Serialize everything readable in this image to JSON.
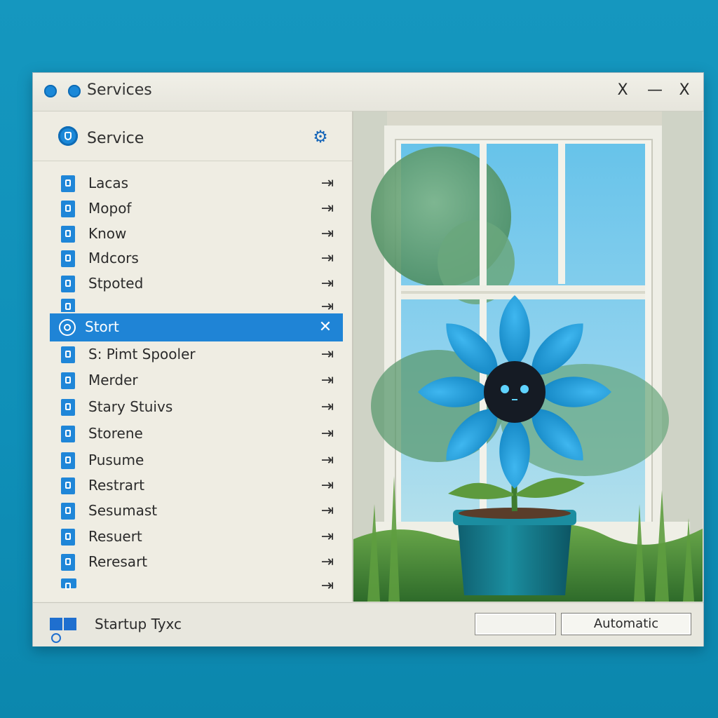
{
  "window": {
    "title": "Services",
    "controls": [
      "X",
      "—",
      "X"
    ]
  },
  "panel": {
    "header_label": "Service",
    "header_icon": "gear-icon",
    "items": [
      {
        "label": "Lacas",
        "action": "⇥"
      },
      {
        "label": "Mopof",
        "action": "⇥"
      },
      {
        "label": "Know",
        "action": "⇥"
      },
      {
        "label": "Mdcors",
        "action": "⇥"
      },
      {
        "label": "Stpoted",
        "action": "⇥"
      },
      {
        "label": "",
        "action": "⇥"
      },
      {
        "label": "Stort",
        "action": "✕",
        "selected": true
      },
      {
        "label": "S: Pimt Spooler",
        "action": "⇥"
      },
      {
        "label": "Merder",
        "action": "⇥"
      },
      {
        "label": "Stary Stuivs",
        "action": "⇥"
      },
      {
        "label": "Storene",
        "action": "⇥"
      },
      {
        "label": "Pusume",
        "action": "⇥"
      },
      {
        "label": "Restrart",
        "action": "⇥"
      },
      {
        "label": "Sesumast",
        "action": "⇥"
      },
      {
        "label": "Resuert",
        "action": "⇥"
      },
      {
        "label": "Reresart",
        "action": "⇥"
      },
      {
        "label": "",
        "action": "⇥"
      }
    ]
  },
  "footer": {
    "label": "Startup Tyxc",
    "button_empty": "",
    "button_automatic": "Automatic"
  },
  "colors": {
    "accent": "#1f84d6",
    "background": "#1597bf",
    "window_bg": "#e8e7de"
  },
  "illustration": {
    "subject": "plant-pot-with-blue-flower-icon"
  }
}
